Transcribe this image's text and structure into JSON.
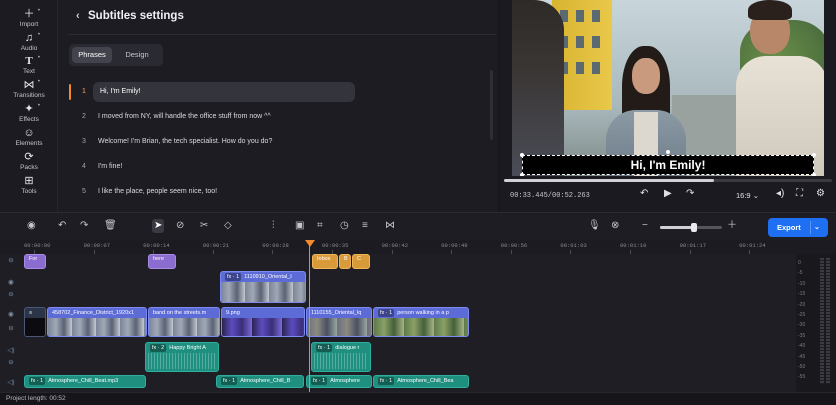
{
  "toolbar_left": [
    {
      "label": "Import",
      "icon": "plus-icon"
    },
    {
      "label": "Audio",
      "icon": "music-note-icon"
    },
    {
      "label": "Text",
      "icon": "text-t-icon"
    },
    {
      "label": "Transitions",
      "icon": "transitions-icon"
    },
    {
      "label": "Effects",
      "icon": "sparkle-icon"
    },
    {
      "label": "Elements",
      "icon": "smiley-icon"
    },
    {
      "label": "Packs",
      "icon": "packs-icon"
    },
    {
      "label": "Tools",
      "icon": "tools-grid-icon"
    }
  ],
  "subtitles": {
    "title": "Subtitles settings",
    "tabs": [
      "Phrases",
      "Design"
    ],
    "active_tab": "Phrases",
    "phrases": [
      {
        "n": "1",
        "text": "Hi, I'm Emily!"
      },
      {
        "n": "2",
        "text": "I moved from NY, will handle the office stuff from now ^^"
      },
      {
        "n": "3",
        "text": "Welcome! I'm Brian, the tech specialist. How do you do?"
      },
      {
        "n": "4",
        "text": "I'm fine!"
      },
      {
        "n": "5",
        "text": "I like the place, people seem nice, too!"
      }
    ]
  },
  "preview": {
    "caption": "Hi, I'm Emily!",
    "timecode": "00:33.445/00:52.263",
    "aspect_ratio": "16:9",
    "progress": 0.64
  },
  "timeline_toolbar": {
    "export_label": "Export",
    "zoom_level": 0.55
  },
  "ruler": [
    "00:00:00",
    "00:00:07",
    "00:00:14",
    "00:00:21",
    "00:00:28",
    "00:00:35",
    "00:00:42",
    "00:00:49",
    "00:00:56",
    "00:01:03",
    "00:01:10",
    "00:01:17",
    "00:01:24"
  ],
  "clips": {
    "titles": [
      "For",
      "here",
      "Inbox",
      "B",
      "C"
    ],
    "overlay_video": {
      "fx": "fx · 1",
      "name": "1110910_Oriental_I"
    },
    "main_video": [
      {
        "name": "458702_Finance_District_1920x1"
      },
      {
        "name": "band on the streets.m"
      },
      {
        "name": "9.png"
      },
      {
        "name": "1110155_Oriental_lq",
        "fx": "fx · 1"
      },
      {
        "name": "person walking in a p",
        "fx": "fx · 1"
      }
    ],
    "overlay_audio": [
      {
        "fx": "fx · 2",
        "name": "Happy Bright A"
      },
      {
        "fx": "fx · 1",
        "name": "dialogue r"
      }
    ],
    "music": [
      {
        "fx": "fx · 1",
        "name": "Atmosphere_Chill_Beat.mp3"
      },
      {
        "fx": "fx · 1",
        "name": "Atmosphere_Chill_B"
      },
      {
        "fx": "fx · 1",
        "name": "Atmosphere"
      },
      {
        "fx": "fx · 1",
        "name": "Atmosphere_Chill_Bea"
      }
    ]
  },
  "vu_labels": [
    "0",
    "-5",
    "-10",
    "-15",
    "-20",
    "-25",
    "-30",
    "-35",
    "-40",
    "-45",
    "-50",
    "-55"
  ],
  "status": {
    "project_length": "Project length: 00:52"
  },
  "colors": {
    "accent": "#1f6ff2",
    "playhead": "#f08a2c",
    "video_clip": "#5c6bd6",
    "audio_clip": "#1f8f80",
    "title_clip": "#8a6dcf"
  }
}
